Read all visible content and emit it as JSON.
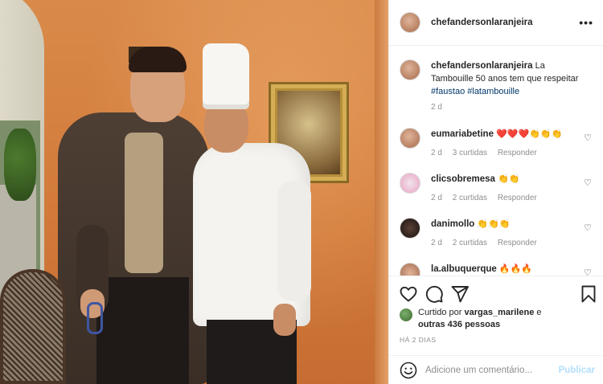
{
  "post": {
    "username": "chefandersonlaranjeira",
    "more_label": "•••",
    "caption": {
      "username": "chefandersonlaranjeira",
      "text": "La Tambouille 50 anos tem que respeitar",
      "tags": "#faustao #latambouille",
      "time": "2 d"
    }
  },
  "comments": [
    {
      "username": "eumariabetine",
      "text": "❤️❤️❤️👏👏👏",
      "time": "2 d",
      "likes": "3 curtidas",
      "reply": "Responder"
    },
    {
      "username": "clicsobremesa",
      "text": "👏👏",
      "time": "2 d",
      "likes": "2 curtidas",
      "reply": "Responder"
    },
    {
      "username": "danimollo",
      "text": "👏👏👏",
      "time": "2 d",
      "likes": "2 curtidas",
      "reply": "Responder"
    },
    {
      "username": "la.albuquerque",
      "text": "🔥🔥🔥",
      "time": "",
      "likes": "",
      "reply": ""
    }
  ],
  "likes": {
    "prefix": "Curtido por",
    "user": "vargas_marilene",
    "connector": "e",
    "others": "outras 436 pessoas"
  },
  "time_ago": "HÁ 2 DIAS",
  "add_comment": {
    "placeholder": "Adicione um comentário...",
    "post_label": "Publicar"
  },
  "icons": {
    "like": "heart-icon",
    "comment": "comment-icon",
    "share": "paper-plane-icon",
    "save": "bookmark-icon",
    "emoji": "smiley-icon"
  }
}
